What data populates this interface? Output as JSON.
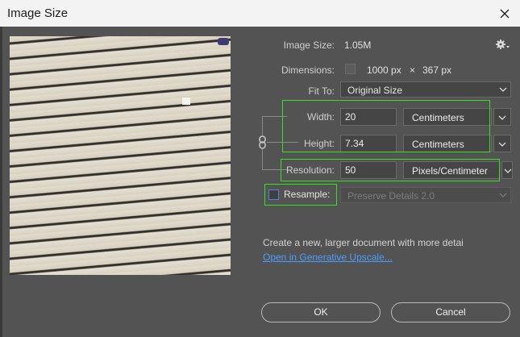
{
  "window": {
    "title": "Image Size"
  },
  "info": {
    "image_size_label": "Image Size:",
    "image_size_value": "1.05M",
    "dimensions_label": "Dimensions:",
    "dim_width": "1000 px",
    "dim_times": "×",
    "dim_height": "367 px",
    "fit_to_label": "Fit To:",
    "fit_to_value": "Original Size"
  },
  "fields": {
    "width_label": "Width:",
    "width_value": "20",
    "width_unit": "Centimeters",
    "height_label": "Height:",
    "height_value": "7.34",
    "height_unit": "Centimeters",
    "resolution_label": "Resolution:",
    "resolution_value": "50",
    "resolution_unit": "Pixels/Centimeter",
    "resample_label": "Resample:",
    "resample_method": "Preserve Details 2.0"
  },
  "footer": {
    "upscale_text": "Create a new, larger document with more detai",
    "upscale_link": "Open in Generative Upscale...",
    "ok_label": "OK",
    "cancel_label": "Cancel"
  },
  "icons": [
    "close-icon",
    "gear-icon",
    "chevron-down-icon",
    "link-chain-icon"
  ],
  "colors": {
    "highlight": "#35e01e",
    "link": "#4a9fff",
    "background": "#535353"
  }
}
